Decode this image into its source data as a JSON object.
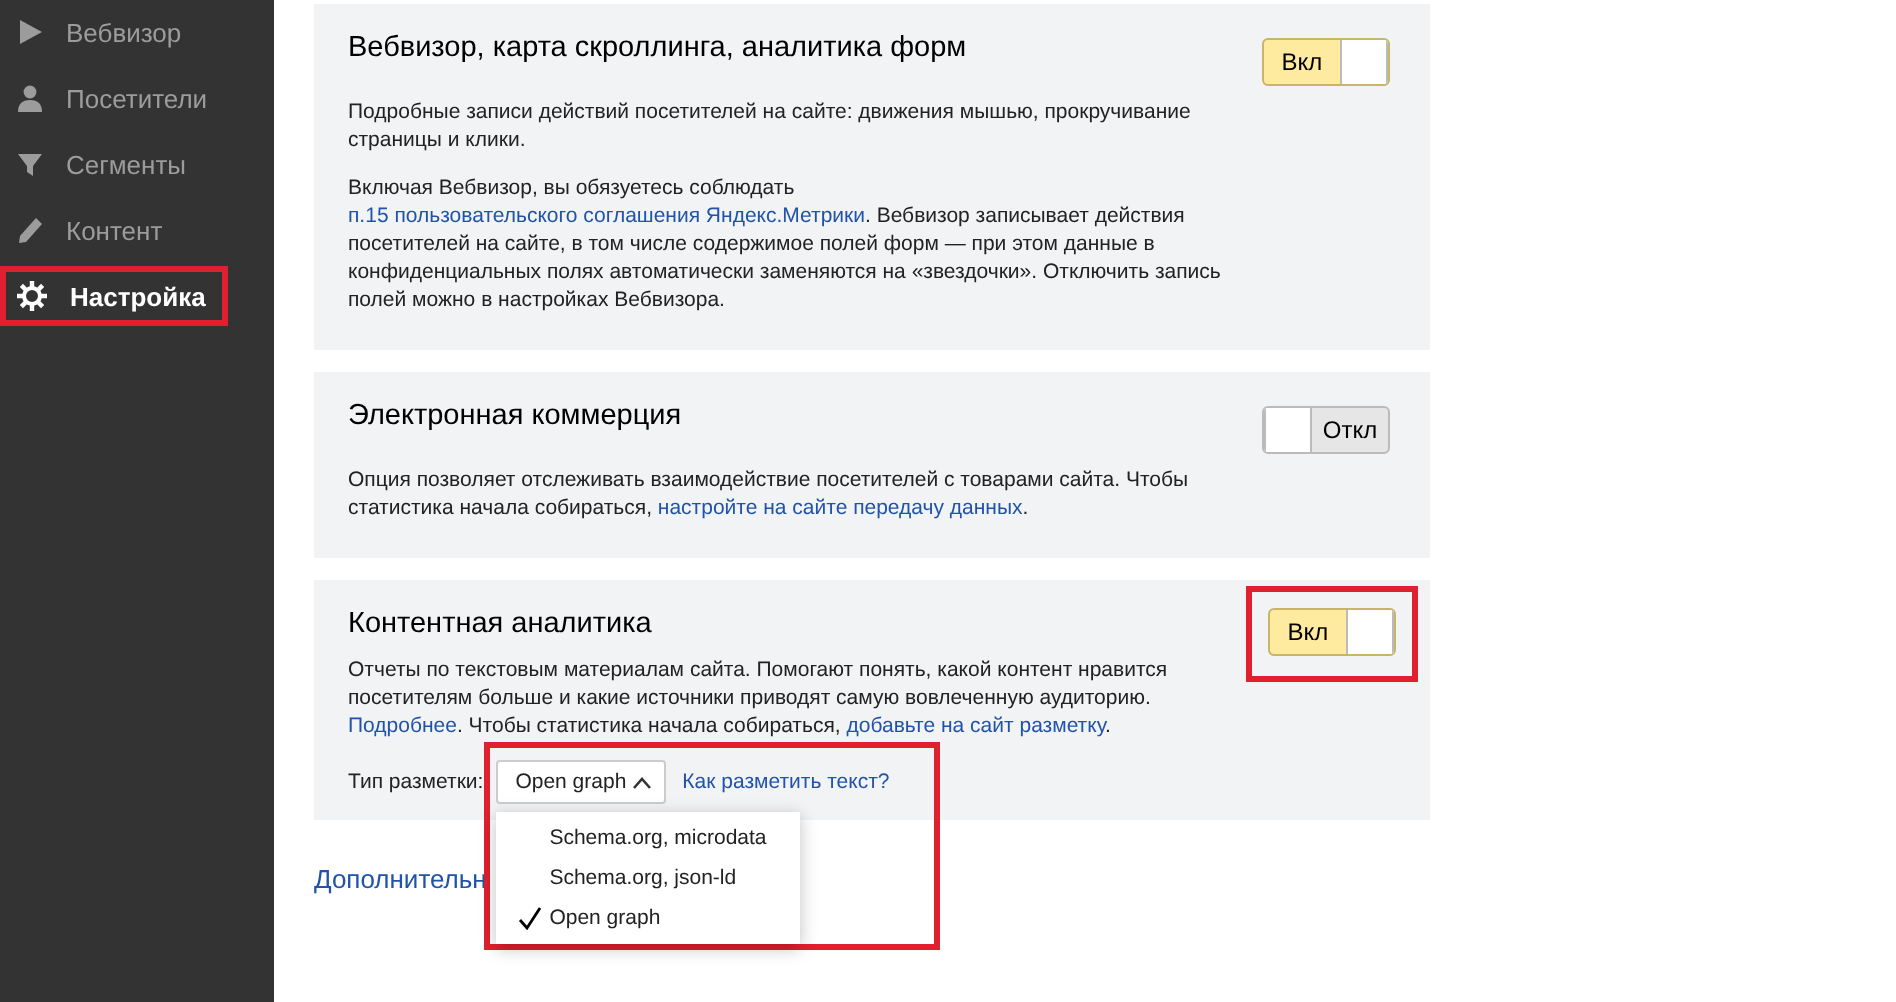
{
  "sidebar": {
    "items": [
      {
        "label": "Вебвизор",
        "selected": false,
        "highlighted": false
      },
      {
        "label": "Посетители",
        "selected": false,
        "highlighted": false
      },
      {
        "label": "Сегменты",
        "selected": false,
        "highlighted": false
      },
      {
        "label": "Контент",
        "selected": false,
        "highlighted": false
      },
      {
        "label": "Настройка",
        "selected": true,
        "highlighted": true
      }
    ]
  },
  "sections": [
    {
      "title": "Вебвизор, карта скроллинга, аналитика форм",
      "toggle": {
        "on": true,
        "label": "Вкл"
      },
      "paragraphs": [
        [
          {
            "text": "Подробные записи действий посетителей на сайте: движения мышью, прокручивание страницы и клики."
          }
        ],
        [
          {
            "text": "Включая Вебвизор, вы обязуетесь соблюдать "
          },
          {
            "text": "п.15 пользовательского соглашения Яндекс.Метрики",
            "link": true
          },
          {
            "text": ". Вебвизор записывает действия посетителей на сайте, в том числе содержимое полей форм — при этом данные в конфиденциальных полях автоматически заменяются на «звездочки». Отключить запись полей можно в настройках Вебвизора."
          }
        ]
      ]
    },
    {
      "title": "Электронная коммерция",
      "toggle": {
        "on": false,
        "label": "Откл"
      },
      "paragraphs": [
        [
          {
            "text": "Опция позволяет отслеживать взаимодействие посетителей с товарами сайта. Чтобы статистика начала собираться, "
          },
          {
            "text": "настройте на сайте передачу данных",
            "link": true
          },
          {
            "text": "."
          }
        ]
      ]
    },
    {
      "title": "Контентная аналитика",
      "toggle": {
        "on": true,
        "label": "Вкл",
        "highlighted": true
      },
      "paragraphs": [
        [
          {
            "text": "Отчеты по текстовым материалам сайта. Помогают понять, какой контент нравится посетителям больше и какие источники приводят самую вовлеченную аудиторию. "
          },
          {
            "text": "Подробнее",
            "link": true
          },
          {
            "text": ". Чтобы статистика начала собираться, "
          },
          {
            "text": "добавьте на сайт разметку",
            "link": true
          },
          {
            "text": "."
          }
        ]
      ],
      "markup": {
        "label": "Тип разметки:",
        "value": "Open graph",
        "help_link": "Как разметить текст?",
        "highlighted": true,
        "expanded": true,
        "options": [
          {
            "label": "Schema.org, microdata",
            "selected": false
          },
          {
            "label": "Schema.org, json-ld",
            "selected": false
          },
          {
            "label": "Open graph",
            "selected": true
          }
        ]
      }
    }
  ],
  "more_link": "Дополнительн"
}
